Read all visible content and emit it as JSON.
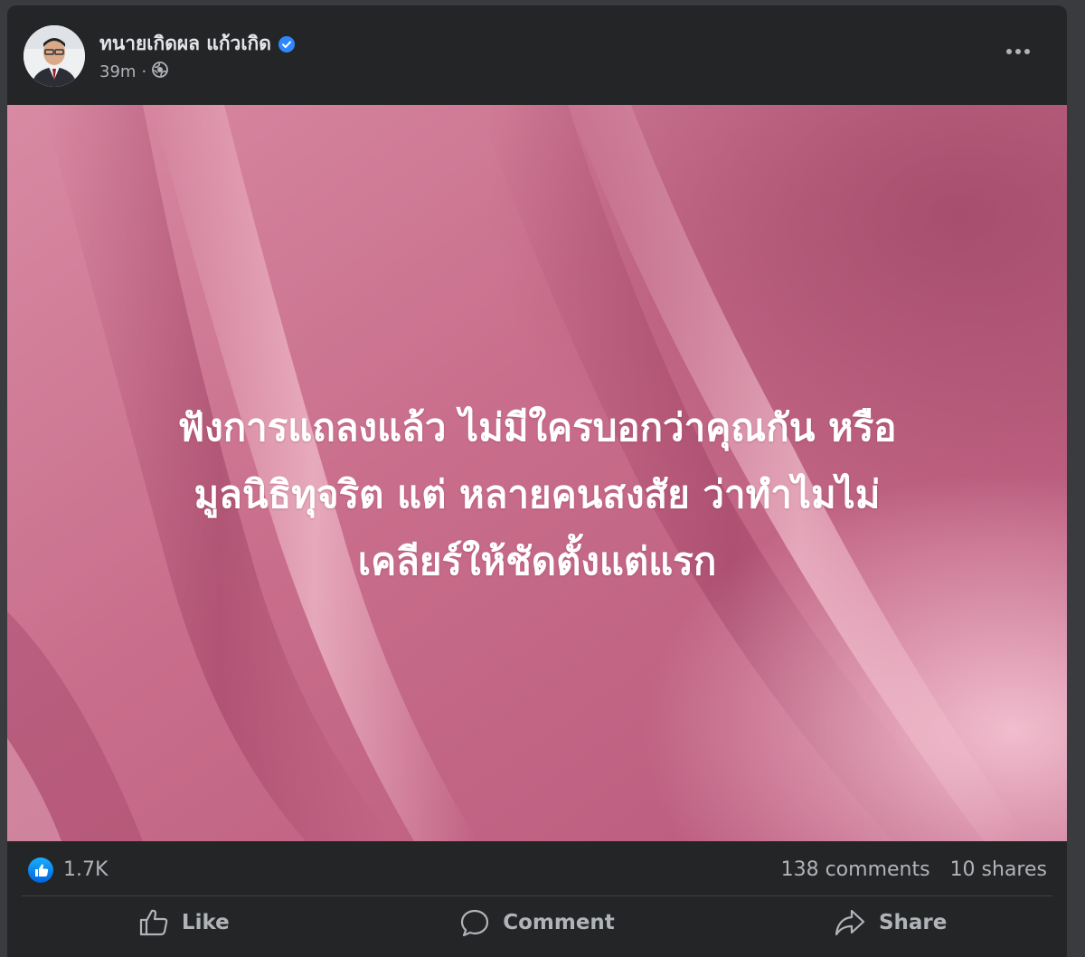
{
  "post": {
    "author_name": "ทนายเกิดผล แก้วเกิด",
    "time": "39m",
    "separator": "·",
    "image_text": [
      "ฟังการแถลงแล้ว ไม่มีใครบอกว่าคุณกัน หรือ",
      "มูลนิธิทุจริต แต่ หลายคนสงสัย ว่าทำไมไม่",
      "เคลียร์ให้ชัดตั้งแต่แรก"
    ]
  },
  "stats": {
    "likes": "1.7K",
    "comments": "138 comments",
    "shares": "10 shares"
  },
  "actions": {
    "like": "Like",
    "comment": "Comment",
    "share": "Share"
  },
  "colors": {
    "background": "#242526",
    "text_secondary": "#b0b3b8",
    "verified_blue": "#2d88ff",
    "image_pink": "#c56f8c"
  },
  "icons": [
    "verified-badge-icon",
    "globe-icon",
    "more-options-icon",
    "like-reaction-icon",
    "thumbs-up-icon",
    "comment-icon",
    "share-icon"
  ]
}
